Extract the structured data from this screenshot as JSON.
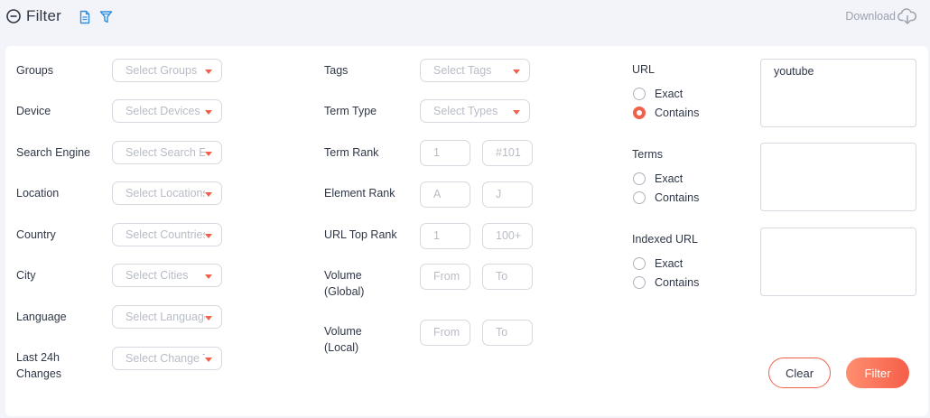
{
  "header": {
    "title": "Filter",
    "download_label": "Download",
    "icons": [
      "collapse-icon",
      "document-icon",
      "filter-funnel-icon",
      "cloud-download-icon"
    ]
  },
  "col1": {
    "groups": {
      "label": "Groups",
      "placeholder": "Select Groups"
    },
    "device": {
      "label": "Device",
      "placeholder": "Select Devices"
    },
    "search_engine": {
      "label": "Search Engine",
      "placeholder": "Select Search En"
    },
    "location": {
      "label": "Location",
      "placeholder": "Select Locations"
    },
    "country": {
      "label": "Country",
      "placeholder": "Select Countries"
    },
    "city": {
      "label": "City",
      "placeholder": "Select Cities"
    },
    "language": {
      "label": "Language",
      "placeholder": "Select Languages"
    },
    "changes": {
      "label_line1": "Last 24h",
      "label_line2": "Changes",
      "placeholder": "Select Change T"
    }
  },
  "col2": {
    "tags": {
      "label": "Tags",
      "placeholder": "Select Tags"
    },
    "term_type": {
      "label": "Term Type",
      "placeholder": "Select Types"
    },
    "term_rank": {
      "label": "Term Rank",
      "from_placeholder": "1",
      "to_placeholder": "#101"
    },
    "element_rank": {
      "label": "Element Rank",
      "from_placeholder": "A",
      "to_placeholder": "J"
    },
    "url_top_rank": {
      "label": "URL Top Rank",
      "from_placeholder": "1",
      "to_placeholder": "100+"
    },
    "volume_global": {
      "label_line1": "Volume",
      "label_line2": "(Global)",
      "from_placeholder": "From",
      "to_placeholder": "To"
    },
    "volume_local": {
      "label_line1": "Volume",
      "label_line2": "(Local)",
      "from_placeholder": "From",
      "to_placeholder": "To"
    }
  },
  "col3": {
    "url": {
      "label": "URL",
      "value": "youtube",
      "exact_label": "Exact",
      "contains_label": "Contains",
      "selected": "contains"
    },
    "terms": {
      "label": "Terms",
      "value": "",
      "exact_label": "Exact",
      "contains_label": "Contains",
      "selected": "none"
    },
    "indexed_url": {
      "label": "Indexed URL",
      "value": "",
      "exact_label": "Exact",
      "contains_label": "Contains",
      "selected": "none"
    }
  },
  "actions": {
    "clear_label": "Clear",
    "filter_label": "Filter"
  },
  "colors": {
    "accent": "#f0604a",
    "background": "#f3f4f9",
    "panel": "#ffffff"
  }
}
